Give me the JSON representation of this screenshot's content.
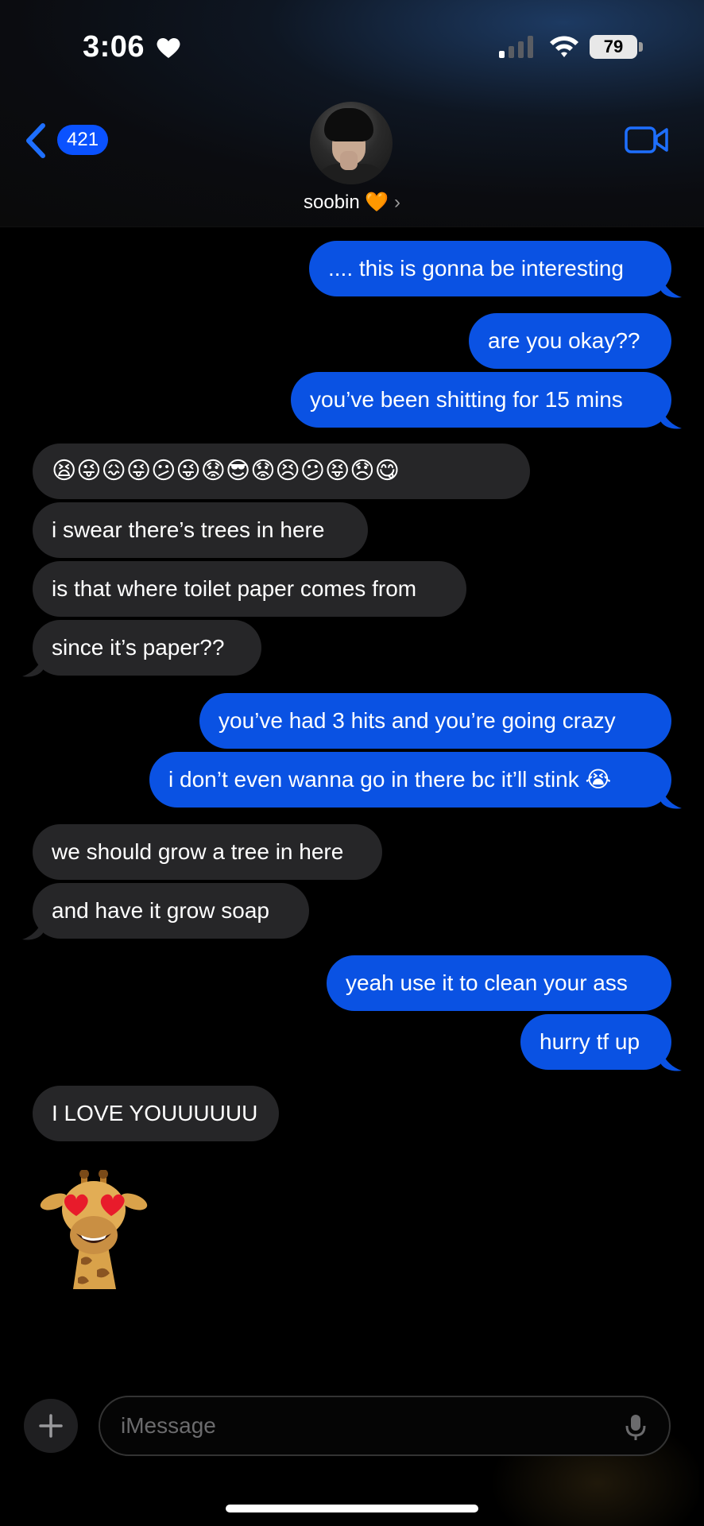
{
  "status_bar": {
    "time": "3:06",
    "battery": "79"
  },
  "header": {
    "back_count": "421",
    "contact_name": "soobin 🧡",
    "contact_chevron": "›"
  },
  "messages": [
    {
      "direction": "sent",
      "text": ".... this is gonna be interesting"
    },
    {
      "direction": "sent",
      "text": "are you okay??"
    },
    {
      "direction": "sent",
      "text": "you’ve been shitting for 15 mins"
    },
    {
      "direction": "received",
      "text": "😫😜😖😜😕😜😟😎😟😣😕😝😞😋"
    },
    {
      "direction": "received",
      "text": "i swear there’s trees in here"
    },
    {
      "direction": "received",
      "text": "is that where toilet paper comes from"
    },
    {
      "direction": "received",
      "text": "since it’s paper??"
    },
    {
      "direction": "sent",
      "text": "you’ve had 3 hits and you’re going crazy"
    },
    {
      "direction": "sent",
      "text": "i don’t even wanna go in there bc it’ll stink 😭"
    },
    {
      "direction": "received",
      "text": "we should grow a tree in here"
    },
    {
      "direction": "received",
      "text": "and have it grow soap"
    },
    {
      "direction": "sent",
      "text": "yeah use it to clean your ass"
    },
    {
      "direction": "sent",
      "text": "hurry tf up"
    },
    {
      "direction": "received",
      "text": "I LOVE YOUUUUUU"
    }
  ],
  "composer": {
    "placeholder": "iMessage"
  },
  "colors": {
    "sent_bubble": "#0a52e3",
    "received_bubble": "#262628",
    "accent": "#1e6fff"
  }
}
